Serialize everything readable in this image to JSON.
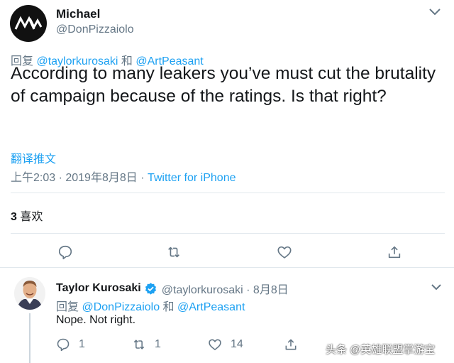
{
  "main_tweet": {
    "author_name": "Michael",
    "author_handle": "@DonPizzaiolo",
    "replying_prefix": "回复",
    "replying_mention_1": "@taylorkurosaki",
    "replying_and": "和",
    "replying_mention_2": "@ArtPeasant",
    "text": "According to many leakers you’ve must cut the brutality of campaign because of the ratings. Is that right?",
    "translate_label": "翻译推文",
    "time": "上午2:03 · 2019年8月8日 ·",
    "source": "Twitter for iPhone",
    "likes_count": "3",
    "likes_label": "喜欢"
  },
  "reply_tweet": {
    "author_name": "Taylor Kurosaki",
    "author_handle": "@taylorkurosaki · 8月8日",
    "replying_prefix": "回复",
    "replying_mention_1": "@DonPizzaiolo",
    "replying_and": "和",
    "replying_mention_2": "@ArtPeasant",
    "text": "Nope. Not right.",
    "reply_count": "1",
    "retweet_count": "1",
    "like_count": "14"
  },
  "watermark": "头条 @英雄联盟掌游宝",
  "colors": {
    "accent": "#1da1f2",
    "secondary_text": "#657786",
    "primary_text": "#14171a",
    "divider": "#e1e8ed"
  },
  "icons": {
    "main_avatar": "mw-logo-avatar",
    "menu": "chevron-down-icon",
    "reply": "reply-bubble-icon",
    "retweet": "retweet-icon",
    "like": "heart-icon",
    "share": "share-icon",
    "verified": "verified-badge-icon"
  }
}
